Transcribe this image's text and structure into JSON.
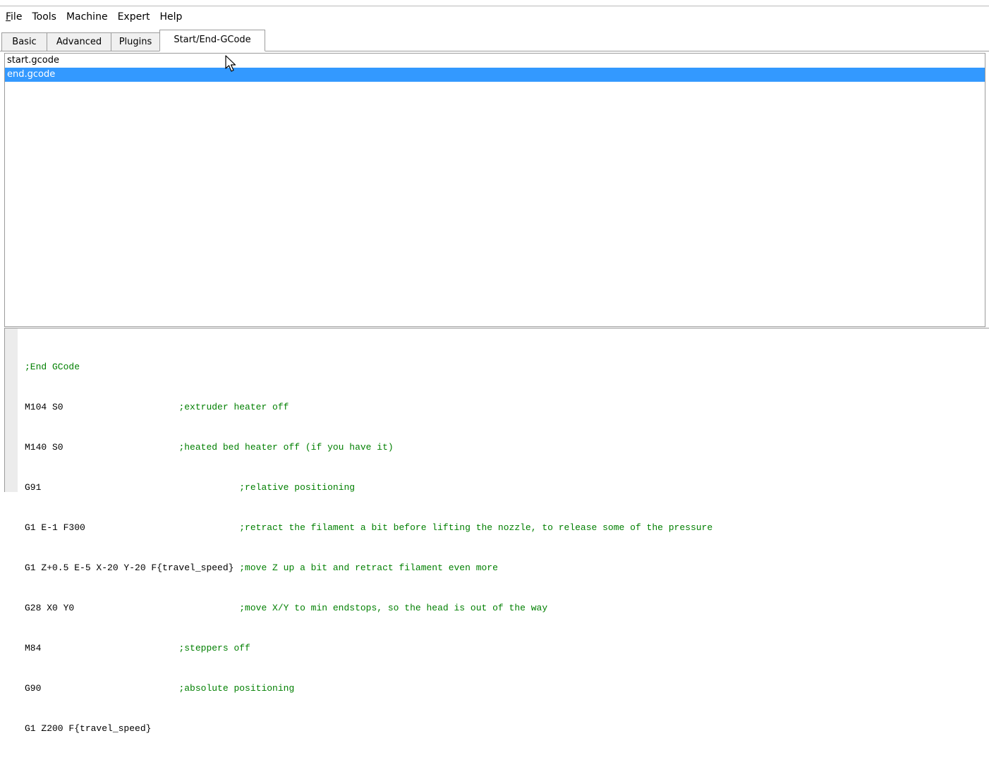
{
  "menu": [
    {
      "label_accel": "F",
      "label_rest": "ile"
    },
    {
      "label_accel": "",
      "label_rest": "Tools"
    },
    {
      "label_accel": "",
      "label_rest": "Machine"
    },
    {
      "label_accel": "",
      "label_rest": "Expert"
    },
    {
      "label_accel": "",
      "label_rest": "Help"
    }
  ],
  "tabs": [
    {
      "label": "Basic",
      "active": false
    },
    {
      "label": "Advanced",
      "active": false
    },
    {
      "label": "Plugins",
      "active": false
    },
    {
      "label": "Start/End-GCode",
      "active": true
    }
  ],
  "file_list": [
    {
      "label": "start.gcode",
      "selected": false
    },
    {
      "label": "end.gcode",
      "selected": true
    }
  ],
  "colors": {
    "selection": "#3399ff",
    "comment": "#007f00"
  },
  "editor": {
    "lines": [
      {
        "cmd": "",
        "comment": ";End GCode"
      },
      {
        "cmd": "M104 S0                     ",
        "comment": ";extruder heater off"
      },
      {
        "cmd": "M140 S0                     ",
        "comment": ";heated bed heater off (if you have it)"
      },
      {
        "cmd": "G91                                    ",
        "comment": ";relative positioning"
      },
      {
        "cmd": "G1 E-1 F300                            ",
        "comment": ";retract the filament a bit before lifting the nozzle, to release some of the pressure"
      },
      {
        "cmd": "G1 Z+0.5 E-5 X-20 Y-20 F{travel_speed} ",
        "comment": ";move Z up a bit and retract filament even more"
      },
      {
        "cmd": "G28 X0 Y0                              ",
        "comment": ";move X/Y to min endstops, so the head is out of the way"
      },
      {
        "cmd": "M84                         ",
        "comment": ";steppers off"
      },
      {
        "cmd": "G90                         ",
        "comment": ";absolute positioning"
      },
      {
        "cmd": "G1 Z200 F{travel_speed}",
        "comment": ""
      }
    ]
  }
}
